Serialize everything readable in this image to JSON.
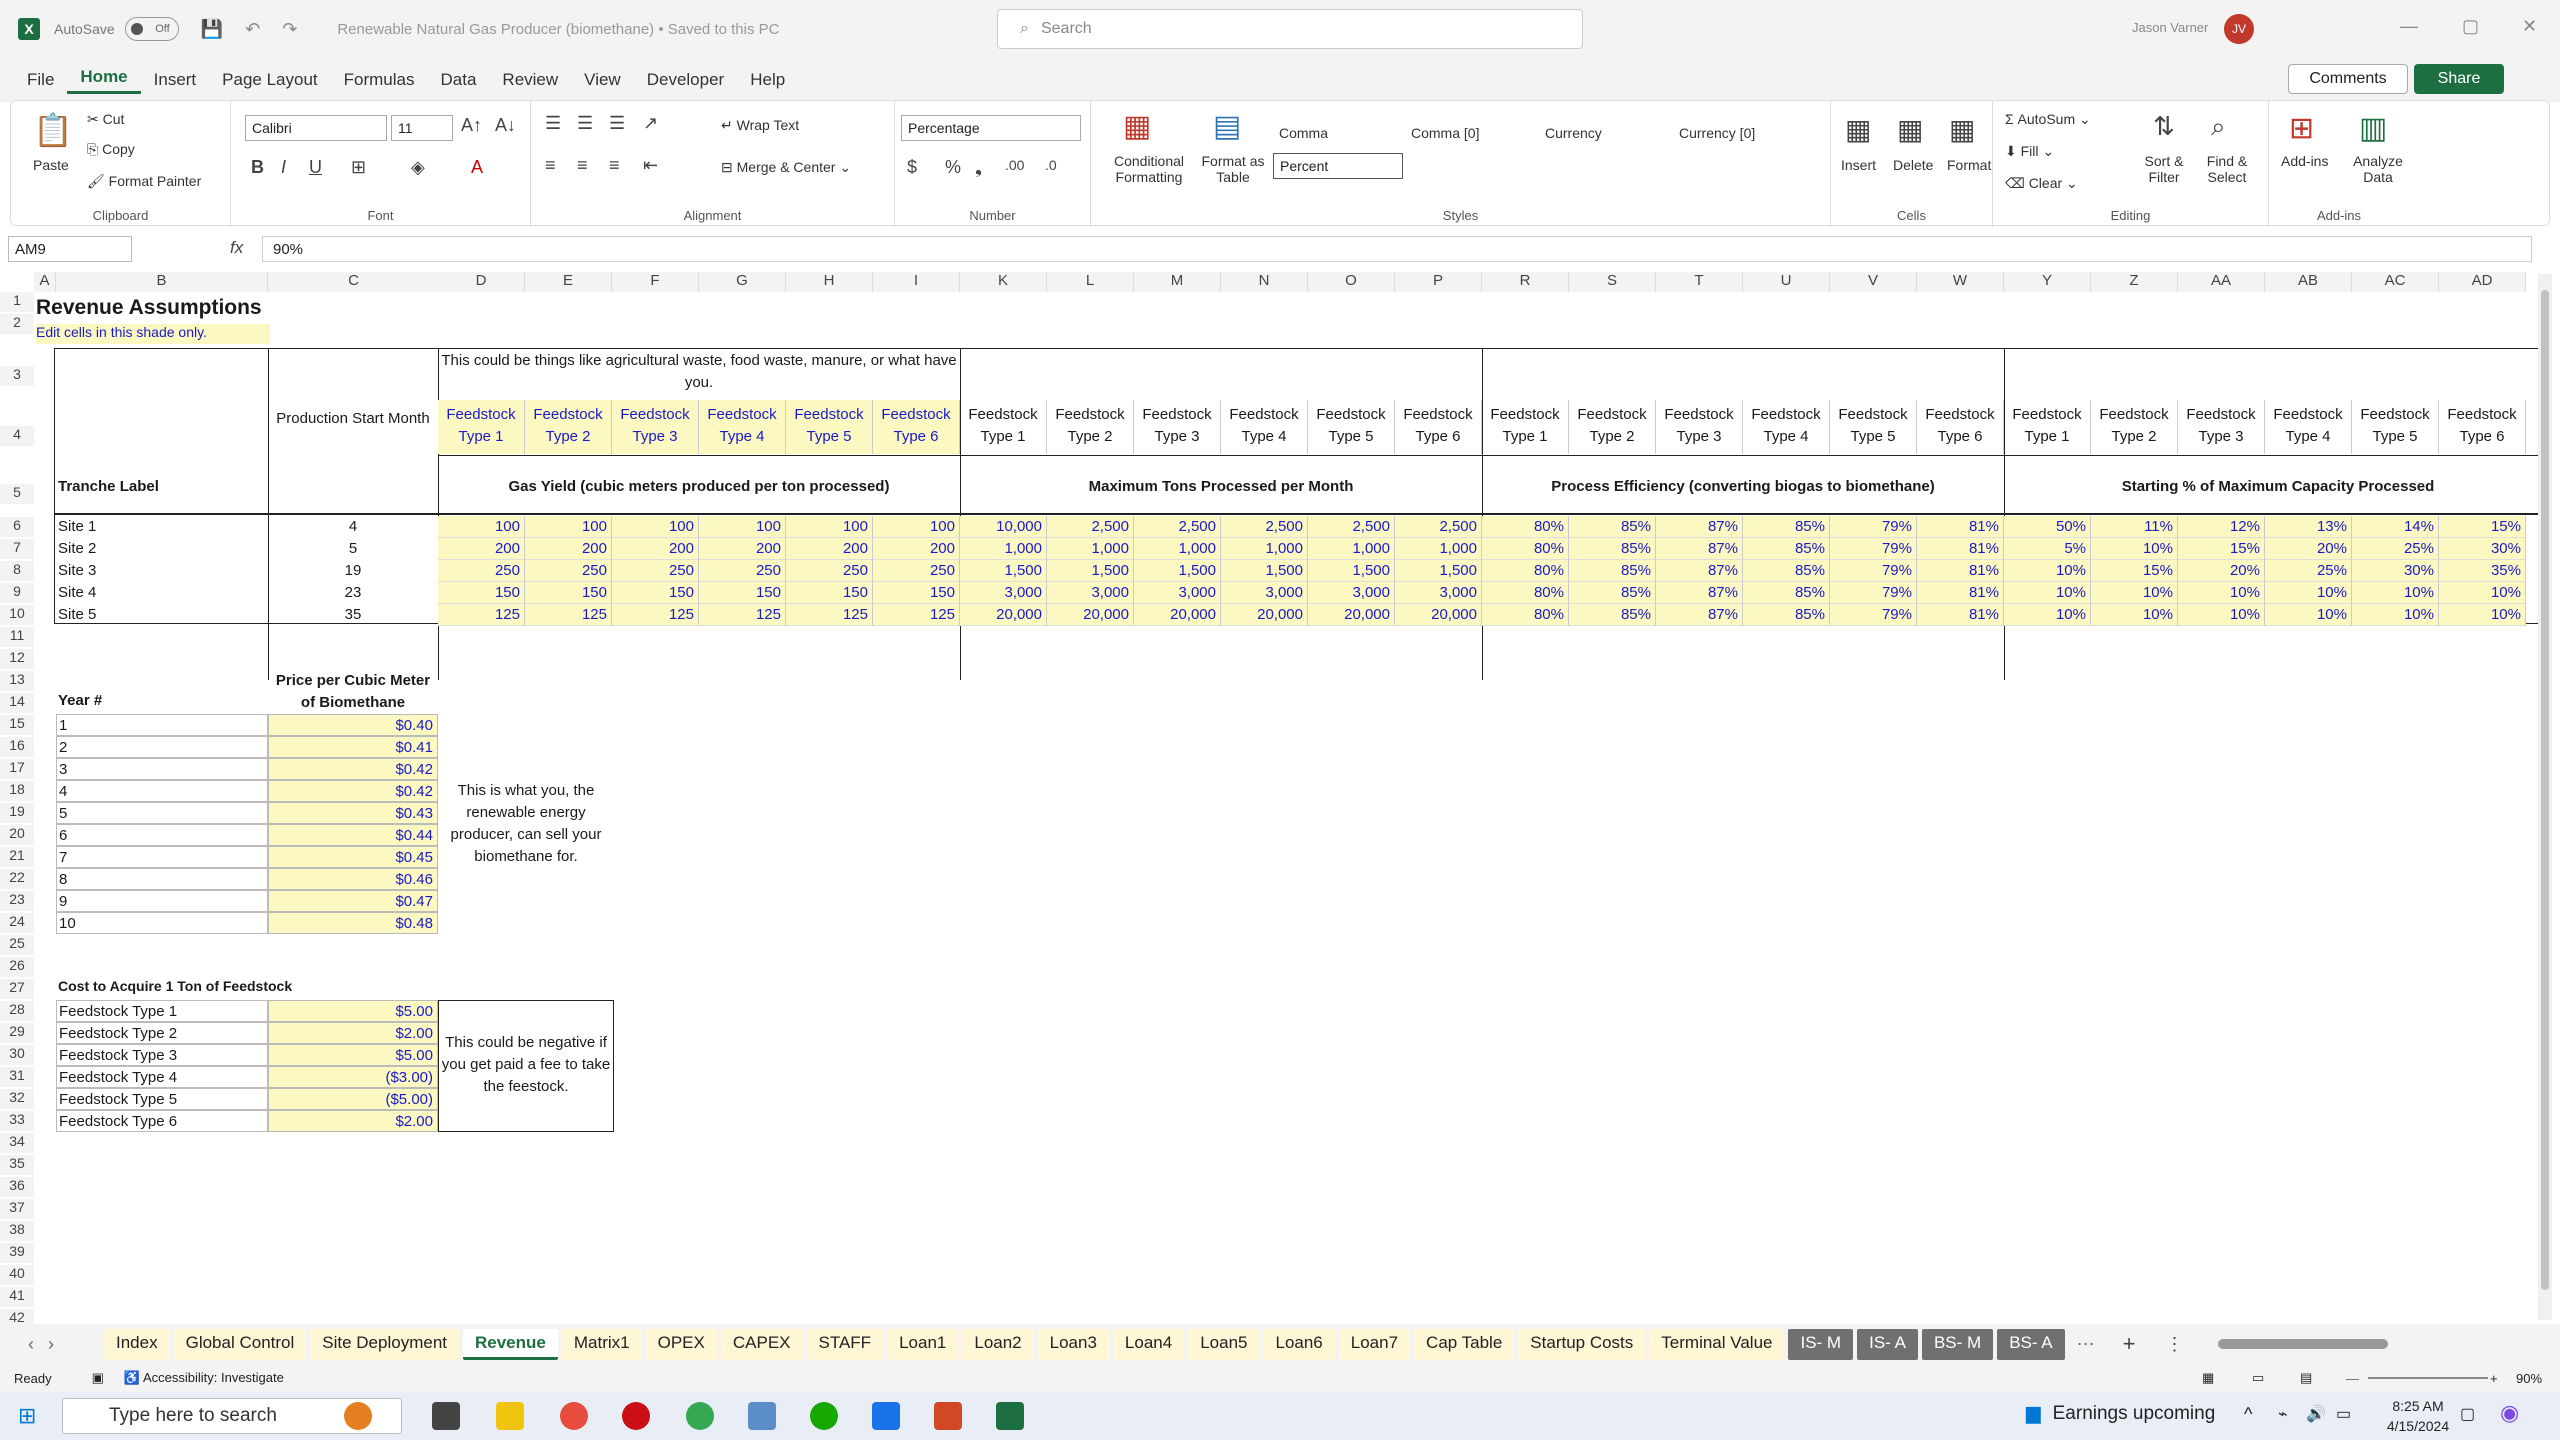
{
  "window": {
    "autosave_label": "AutoSave",
    "autosave_state": "Off",
    "doc_title": "Renewable Natural Gas Producer (biomethane) • Saved to this PC",
    "search_placeholder": "Search",
    "user_name": "Jason Varner",
    "user_initials": "JV"
  },
  "menu": [
    "File",
    "Home",
    "Insert",
    "Page Layout",
    "Formulas",
    "Data",
    "Review",
    "View",
    "Developer",
    "Help"
  ],
  "menu_active": "Home",
  "actions": {
    "comments": "Comments",
    "share": "Share"
  },
  "ribbon": {
    "clipboard": {
      "paste": "Paste",
      "cut": "Cut",
      "copy": "Copy",
      "format_painter": "Format Painter",
      "label": "Clipboard"
    },
    "font": {
      "name": "Calibri",
      "size": "11",
      "label": "Font"
    },
    "alignment": {
      "wrap_text": "Wrap Text",
      "merge_center": "Merge & Center",
      "label": "Alignment"
    },
    "number": {
      "format": "Percentage",
      "label": "Number"
    },
    "styles": {
      "conditional": "Conditional Formatting",
      "format_table": "Format as Table",
      "comma": "Comma",
      "comma0": "Comma [0]",
      "currency": "Currency",
      "currency0": "Currency [0]",
      "percent": "Percent",
      "label": "Styles"
    },
    "cells": {
      "insert": "Insert",
      "delete": "Delete",
      "format": "Format",
      "label": "Cells"
    },
    "editing": {
      "autosum": "AutoSum",
      "fill": "Fill",
      "clear": "Clear",
      "sort": "Sort & Filter",
      "find": "Find & Select",
      "label": "Editing"
    },
    "addins": {
      "addins": "Add-ins",
      "analyze": "Analyze Data",
      "label": "Add-ins"
    }
  },
  "formula": {
    "namebox": "AM9",
    "value": "90%"
  },
  "columns": [
    "A",
    "B",
    "C",
    "D",
    "E",
    "F",
    "G",
    "H",
    "I",
    "K",
    "L",
    "M",
    "N",
    "O",
    "P",
    "R",
    "S",
    "T",
    "U",
    "V",
    "W",
    "Y",
    "Z",
    "AA",
    "AB",
    "AC",
    "AD"
  ],
  "sheet": {
    "title": "Revenue Assumptions",
    "subtitle": "Edit cells in this shade only.",
    "note_feedstock": "This could be things like agricultural waste, food waste, manure, or what have you.",
    "tranche_label": "Tranche Label",
    "production_start": "Production Start Month",
    "group_headers": [
      "Gas Yield (cubic meters produced per ton processed)",
      "Maximum Tons Processed per Month",
      "Process Efficiency (converting biogas to biomethane)",
      "Starting % of Maximum Capacity Processed"
    ],
    "feedstock_types": [
      "Feedstock Type 1",
      "Feedstock Type 2",
      "Feedstock Type 3",
      "Feedstock Type 4",
      "Feedstock Type 5",
      "Feedstock Type 6"
    ],
    "sites": [
      {
        "label": "Site 1",
        "start": "4",
        "gas": [
          "100",
          "100",
          "100",
          "100",
          "100",
          "100"
        ],
        "tons": [
          "10,000",
          "2,500",
          "2,500",
          "2,500",
          "2,500",
          "2,500"
        ],
        "eff": [
          "80%",
          "85%",
          "87%",
          "85%",
          "79%",
          "81%"
        ],
        "cap": [
          "50%",
          "11%",
          "12%",
          "13%",
          "14%",
          "15%"
        ]
      },
      {
        "label": "Site 2",
        "start": "5",
        "gas": [
          "200",
          "200",
          "200",
          "200",
          "200",
          "200"
        ],
        "tons": [
          "1,000",
          "1,000",
          "1,000",
          "1,000",
          "1,000",
          "1,000"
        ],
        "eff": [
          "80%",
          "85%",
          "87%",
          "85%",
          "79%",
          "81%"
        ],
        "cap": [
          "5%",
          "10%",
          "15%",
          "20%",
          "25%",
          "30%"
        ]
      },
      {
        "label": "Site 3",
        "start": "19",
        "gas": [
          "250",
          "250",
          "250",
          "250",
          "250",
          "250"
        ],
        "tons": [
          "1,500",
          "1,500",
          "1,500",
          "1,500",
          "1,500",
          "1,500"
        ],
        "eff": [
          "80%",
          "85%",
          "87%",
          "85%",
          "79%",
          "81%"
        ],
        "cap": [
          "10%",
          "15%",
          "20%",
          "25%",
          "30%",
          "35%"
        ]
      },
      {
        "label": "Site 4",
        "start": "23",
        "gas": [
          "150",
          "150",
          "150",
          "150",
          "150",
          "150"
        ],
        "tons": [
          "3,000",
          "3,000",
          "3,000",
          "3,000",
          "3,000",
          "3,000"
        ],
        "eff": [
          "80%",
          "85%",
          "87%",
          "85%",
          "79%",
          "81%"
        ],
        "cap": [
          "10%",
          "10%",
          "10%",
          "10%",
          "10%",
          "10%"
        ]
      },
      {
        "label": "Site 5",
        "start": "35",
        "gas": [
          "125",
          "125",
          "125",
          "125",
          "125",
          "125"
        ],
        "tons": [
          "20,000",
          "20,000",
          "20,000",
          "20,000",
          "20,000",
          "20,000"
        ],
        "eff": [
          "80%",
          "85%",
          "87%",
          "85%",
          "79%",
          "81%"
        ],
        "cap": [
          "10%",
          "10%",
          "10%",
          "10%",
          "10%",
          "10%"
        ]
      }
    ],
    "year_header": "Year #",
    "price_header": "Price per Cubic Meter of Biomethane",
    "prices": [
      {
        "year": "1",
        "price": "$0.40"
      },
      {
        "year": "2",
        "price": "$0.41"
      },
      {
        "year": "3",
        "price": "$0.42"
      },
      {
        "year": "4",
        "price": "$0.42"
      },
      {
        "year": "5",
        "price": "$0.43"
      },
      {
        "year": "6",
        "price": "$0.44"
      },
      {
        "year": "7",
        "price": "$0.45"
      },
      {
        "year": "8",
        "price": "$0.46"
      },
      {
        "year": "9",
        "price": "$0.47"
      },
      {
        "year": "10",
        "price": "$0.48"
      }
    ],
    "price_note": "This is what you, the renewable energy producer, can sell your biomethane for.",
    "cost_header": "Cost to Acquire 1 Ton of Feedstock",
    "costs": [
      {
        "label": "Feedstock Type 1",
        "value": "$5.00"
      },
      {
        "label": "Feedstock Type 2",
        "value": "$2.00"
      },
      {
        "label": "Feedstock Type 3",
        "value": "$5.00"
      },
      {
        "label": "Feedstock Type 4",
        "value": "($3.00)"
      },
      {
        "label": "Feedstock Type 5",
        "value": "($5.00)"
      },
      {
        "label": "Feedstock Type 6",
        "value": "$2.00"
      }
    ],
    "cost_note": "This could be negative if you get paid a fee to take the feestock."
  },
  "tabs": [
    "Index",
    "Global Control",
    "Site Deployment",
    "Revenue",
    "Matrix1",
    "OPEX",
    "CAPEX",
    "STAFF",
    "Loan1",
    "Loan2",
    "Loan3",
    "Loan4",
    "Loan5",
    "Loan6",
    "Loan7",
    "Cap Table",
    "Startup Costs",
    "Terminal Value",
    "IS- M",
    "IS- A",
    "BS- M",
    "BS- A"
  ],
  "tab_active": "Revenue",
  "status": {
    "ready": "Ready",
    "accessibility": "Accessibility: Investigate",
    "zoom": "90%"
  },
  "taskbar": {
    "search": "Type here to search",
    "news": "Earnings upcoming",
    "time": "8:25 AM",
    "date": "4/15/2024"
  }
}
